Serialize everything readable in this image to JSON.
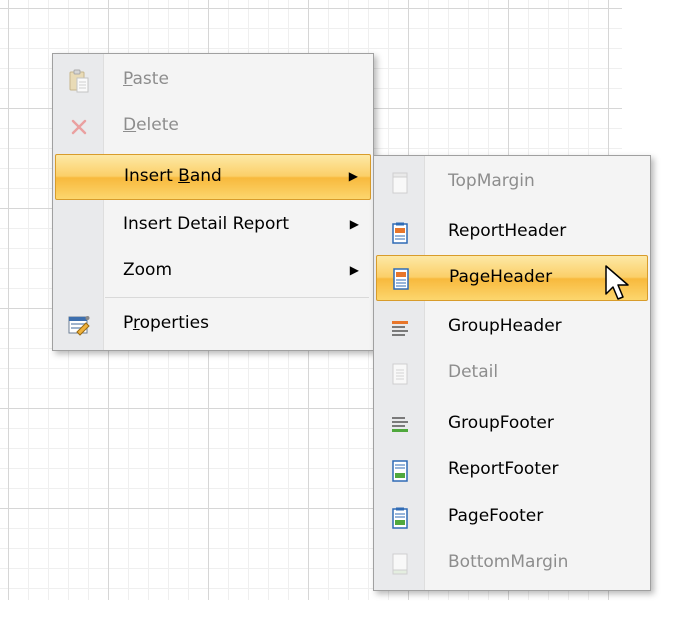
{
  "context_menu": {
    "items": [
      {
        "label_pre": "",
        "label_key": "P",
        "label_post": "aste",
        "icon": "paste-icon",
        "disabled": true
      },
      {
        "label_pre": "",
        "label_key": "D",
        "label_post": "elete",
        "icon": "delete-icon",
        "disabled": true
      },
      {
        "label_pre": "Insert ",
        "label_key": "B",
        "label_post": "and",
        "icon": "",
        "disabled": false,
        "submenu": true,
        "highlighted": true
      },
      {
        "label_pre": "Insert Detail Report",
        "label_key": "",
        "label_post": "",
        "icon": "",
        "disabled": false,
        "submenu": true
      },
      {
        "label_pre": "Zoom",
        "label_key": "",
        "label_post": "",
        "icon": "",
        "disabled": false,
        "submenu": true
      },
      {
        "label_pre": "P",
        "label_key": "r",
        "label_post": "operties",
        "icon": "properties-icon",
        "disabled": false
      }
    ],
    "submenu_arrow": "▶"
  },
  "band_submenu": {
    "items": [
      {
        "label": "TopMargin",
        "icon": "top-margin-band-icon",
        "disabled": true
      },
      {
        "label": "ReportHeader",
        "icon": "report-header-band-icon",
        "disabled": false
      },
      {
        "label": "PageHeader",
        "icon": "page-header-band-icon",
        "disabled": false,
        "highlighted": true
      },
      {
        "label": "GroupHeader",
        "icon": "group-header-band-icon",
        "disabled": false
      },
      {
        "label": "Detail",
        "icon": "detail-band-icon",
        "disabled": true
      },
      {
        "label": "GroupFooter",
        "icon": "group-footer-band-icon",
        "disabled": false
      },
      {
        "label": "ReportFooter",
        "icon": "report-footer-band-icon",
        "disabled": false
      },
      {
        "label": "PageFooter",
        "icon": "page-footer-band-icon",
        "disabled": false
      },
      {
        "label": "BottomMargin",
        "icon": "bottom-margin-band-icon",
        "disabled": true
      }
    ]
  },
  "colors": {
    "highlight_top": "#fde9a6",
    "highlight_bottom": "#f8b93d",
    "band_blue": "#2f6bb5",
    "band_orange": "#e8762a",
    "band_green": "#4fa83d"
  }
}
